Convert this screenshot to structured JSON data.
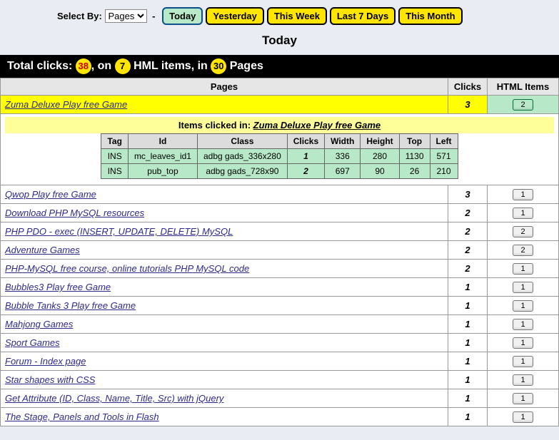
{
  "topbar": {
    "select_label": "Select By:",
    "select_value": "Pages",
    "filters": [
      {
        "label": "Today",
        "active": true
      },
      {
        "label": "Yesterday",
        "active": false
      },
      {
        "label": "This Week",
        "active": false
      },
      {
        "label": "Last 7 Days",
        "active": false
      },
      {
        "label": "This Month",
        "active": false
      }
    ]
  },
  "title": "Today",
  "summary": {
    "prefix": "Total clicks:",
    "clicks": "38",
    "mid1": ", on",
    "items": "7",
    "mid2": "HML items, in",
    "pages": "30",
    "suffix": "Pages"
  },
  "columns": {
    "pages": "Pages",
    "clicks": "Clicks",
    "html_items": "HTML Items"
  },
  "expanded": {
    "label_prefix": "Items clicked in:",
    "page_name": "Zuma Deluxe Play free Game",
    "headers": {
      "tag": "Tag",
      "id": "Id",
      "class": "Class",
      "clicks": "Clicks",
      "width": "Width",
      "height": "Height",
      "top": "Top",
      "left": "Left"
    },
    "rows": [
      {
        "tag": "INS",
        "id": "mc_leaves_id1",
        "class": "adbg gads_336x280",
        "clicks": "1",
        "width": "336",
        "height": "280",
        "top": "1130",
        "left": "571"
      },
      {
        "tag": "INS",
        "id": "pub_top",
        "class": "adbg gads_728x90",
        "clicks": "2",
        "width": "697",
        "height": "90",
        "top": "26",
        "left": "210"
      }
    ]
  },
  "rows": [
    {
      "title": "Zuma Deluxe Play free Game",
      "clicks": "3",
      "count": "2",
      "highlight": true,
      "expand": true
    },
    {
      "title": "Qwop Play free Game",
      "clicks": "3",
      "count": "1"
    },
    {
      "title": "Download PHP MySQL resources",
      "clicks": "2",
      "count": "1"
    },
    {
      "title": "PHP PDO - exec (INSERT, UPDATE, DELETE) MySQL",
      "clicks": "2",
      "count": "2"
    },
    {
      "title": "Adventure Games",
      "clicks": "2",
      "count": "2"
    },
    {
      "title": "PHP-MySQL free course, online tutorials PHP MySQL code",
      "clicks": "2",
      "count": "1"
    },
    {
      "title": "Bubbles3 Play free Game",
      "clicks": "1",
      "count": "1"
    },
    {
      "title": "Bubble Tanks 3 Play free Game",
      "clicks": "1",
      "count": "1"
    },
    {
      "title": "Mahjong Games",
      "clicks": "1",
      "count": "1"
    },
    {
      "title": "Sport Games",
      "clicks": "1",
      "count": "1"
    },
    {
      "title": "Forum - Index page",
      "clicks": "1",
      "count": "1"
    },
    {
      "title": "Star shapes with CSS",
      "clicks": "1",
      "count": "1"
    },
    {
      "title": "Get Attribute (ID, Class, Name, Title, Src) with jQuery",
      "clicks": "1",
      "count": "1"
    },
    {
      "title": "The Stage, Panels and Tools in Flash",
      "clicks": "1",
      "count": "1"
    }
  ]
}
